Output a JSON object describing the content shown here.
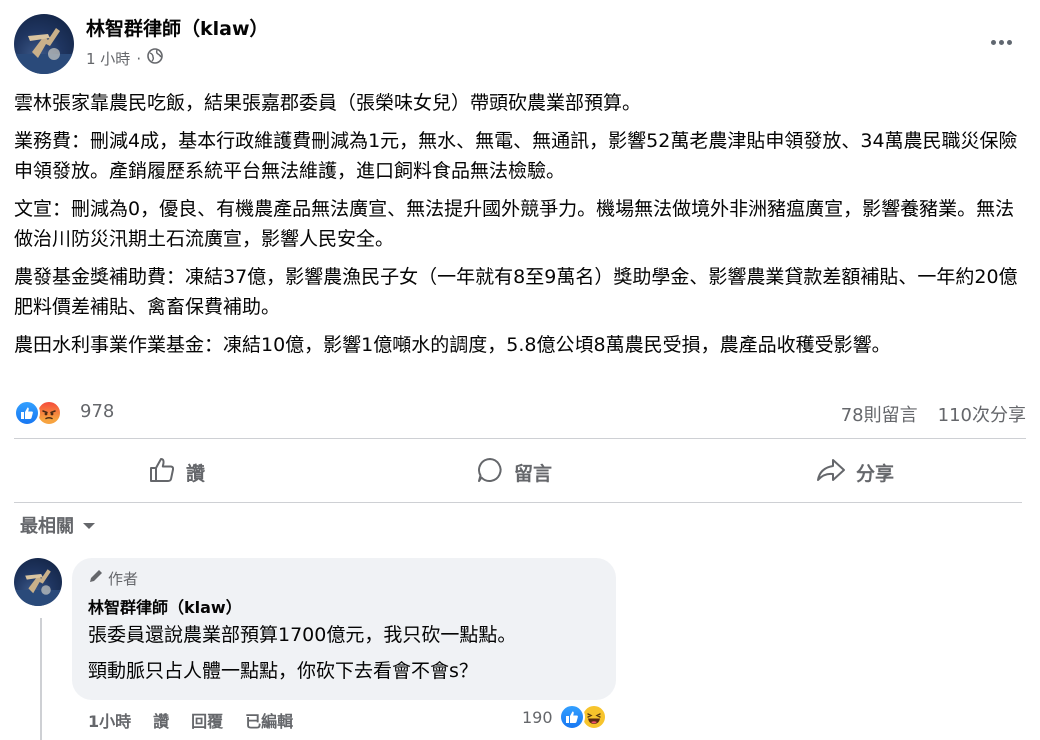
{
  "post": {
    "author": "林智群律師（klaw）",
    "time": "1 小時",
    "separator": "·",
    "paragraphs": [
      "雲林張家靠農民吃飯，結果張嘉郡委員（張榮味女兒）帶頭砍農業部預算。",
      "業務費：刪減4成，基本行政維護費刪減為1元，無水、無電、無通訊，影響52萬老農津貼申領發放、34萬農民職災保險申領發放。產銷履歷系統平台無法維護，進口飼料食品無法檢驗。",
      "文宣：刪減為0，優良、有機農產品無法廣宣、無法提升國外競爭力。機場無法做境外非洲豬瘟廣宣，影響養豬業。無法做治川防災汛期土石流廣宣，影響人民安全。",
      "農發基金獎補助費：凍結37億，影響農漁民子女（一年就有8至9萬名）獎助學金、影響農業貸款差額補貼、一年約20億肥料價差補貼、禽畜保費補助。",
      "農田水利事業作業基金：凍結10億，影響1億噸水的調度，5.8億公頃8萬農民受損，農產品收穫受影響。"
    ],
    "reaction_count": "978",
    "comments_count": "78則留言",
    "shares_count": "110次分享",
    "reaction_icons": [
      "like-icon",
      "angry-icon"
    ]
  },
  "actions": {
    "like": "讚",
    "comment": "留言",
    "share": "分享"
  },
  "comments_filter": "最相關",
  "comment": {
    "tag": "作者",
    "author": "林智群律師（klaw）",
    "lines": [
      "張委員還說農業部預算1700億元，我只砍一點點。",
      "頸動脈只占人體一點點，你砍下去看會不會s？"
    ],
    "time": "1小時",
    "like": "讚",
    "reply": "回覆",
    "edited": "已編輯",
    "reaction_count": "190",
    "reaction_icons": [
      "like-icon",
      "haha-icon"
    ]
  },
  "colors": {
    "accent": "#1877f2",
    "secondary_text": "#65676b",
    "bubble_bg": "#f0f2f5"
  }
}
